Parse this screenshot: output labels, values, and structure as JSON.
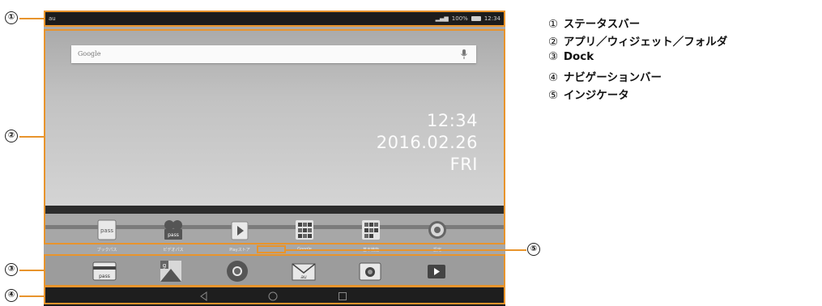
{
  "status_bar": {
    "carrier": "au",
    "signal": "📶",
    "battery_percent": "100%",
    "time": "12:34"
  },
  "home": {
    "search": {
      "logo": "Google"
    },
    "clock": {
      "time": "12:34",
      "date": "2016.02.26",
      "day": "FRI"
    }
  },
  "apps": [
    {
      "label": "ブックパス",
      "icon": "bookpass-icon"
    },
    {
      "label": "ビデオパス",
      "icon": "videopass-icon"
    },
    {
      "label": "Playストア",
      "icon": "playstore-icon"
    },
    {
      "label": "Google",
      "icon": "google-folder-icon"
    },
    {
      "label": "基本機能",
      "icon": "basic-functions-folder-icon"
    },
    {
      "label": "設定",
      "icon": "settings-icon"
    }
  ],
  "dock": [
    {
      "icon": "pass-wallet-icon"
    },
    {
      "icon": "maps-icon"
    },
    {
      "icon": "chrome-icon"
    },
    {
      "icon": "au-mail-icon"
    },
    {
      "icon": "camera-icon"
    },
    {
      "icon": "video-play-icon"
    }
  ],
  "navigation": {
    "back": "◁",
    "home": "○",
    "recent": "□"
  },
  "callouts": {
    "c1": "①",
    "c2": "②",
    "c3": "③",
    "c4": "④",
    "c5": "⑤"
  },
  "legend": [
    {
      "num": "①",
      "text": "ステータスバー"
    },
    {
      "num": "②",
      "text": "アプリ／ウィジェット／フォルダ"
    },
    {
      "num": "③",
      "text": "Dock"
    },
    {
      "num": "④",
      "text": "ナビゲーションバー"
    },
    {
      "num": "⑤",
      "text": "インジケータ"
    }
  ],
  "colors": {
    "callout": "#e8942c"
  }
}
